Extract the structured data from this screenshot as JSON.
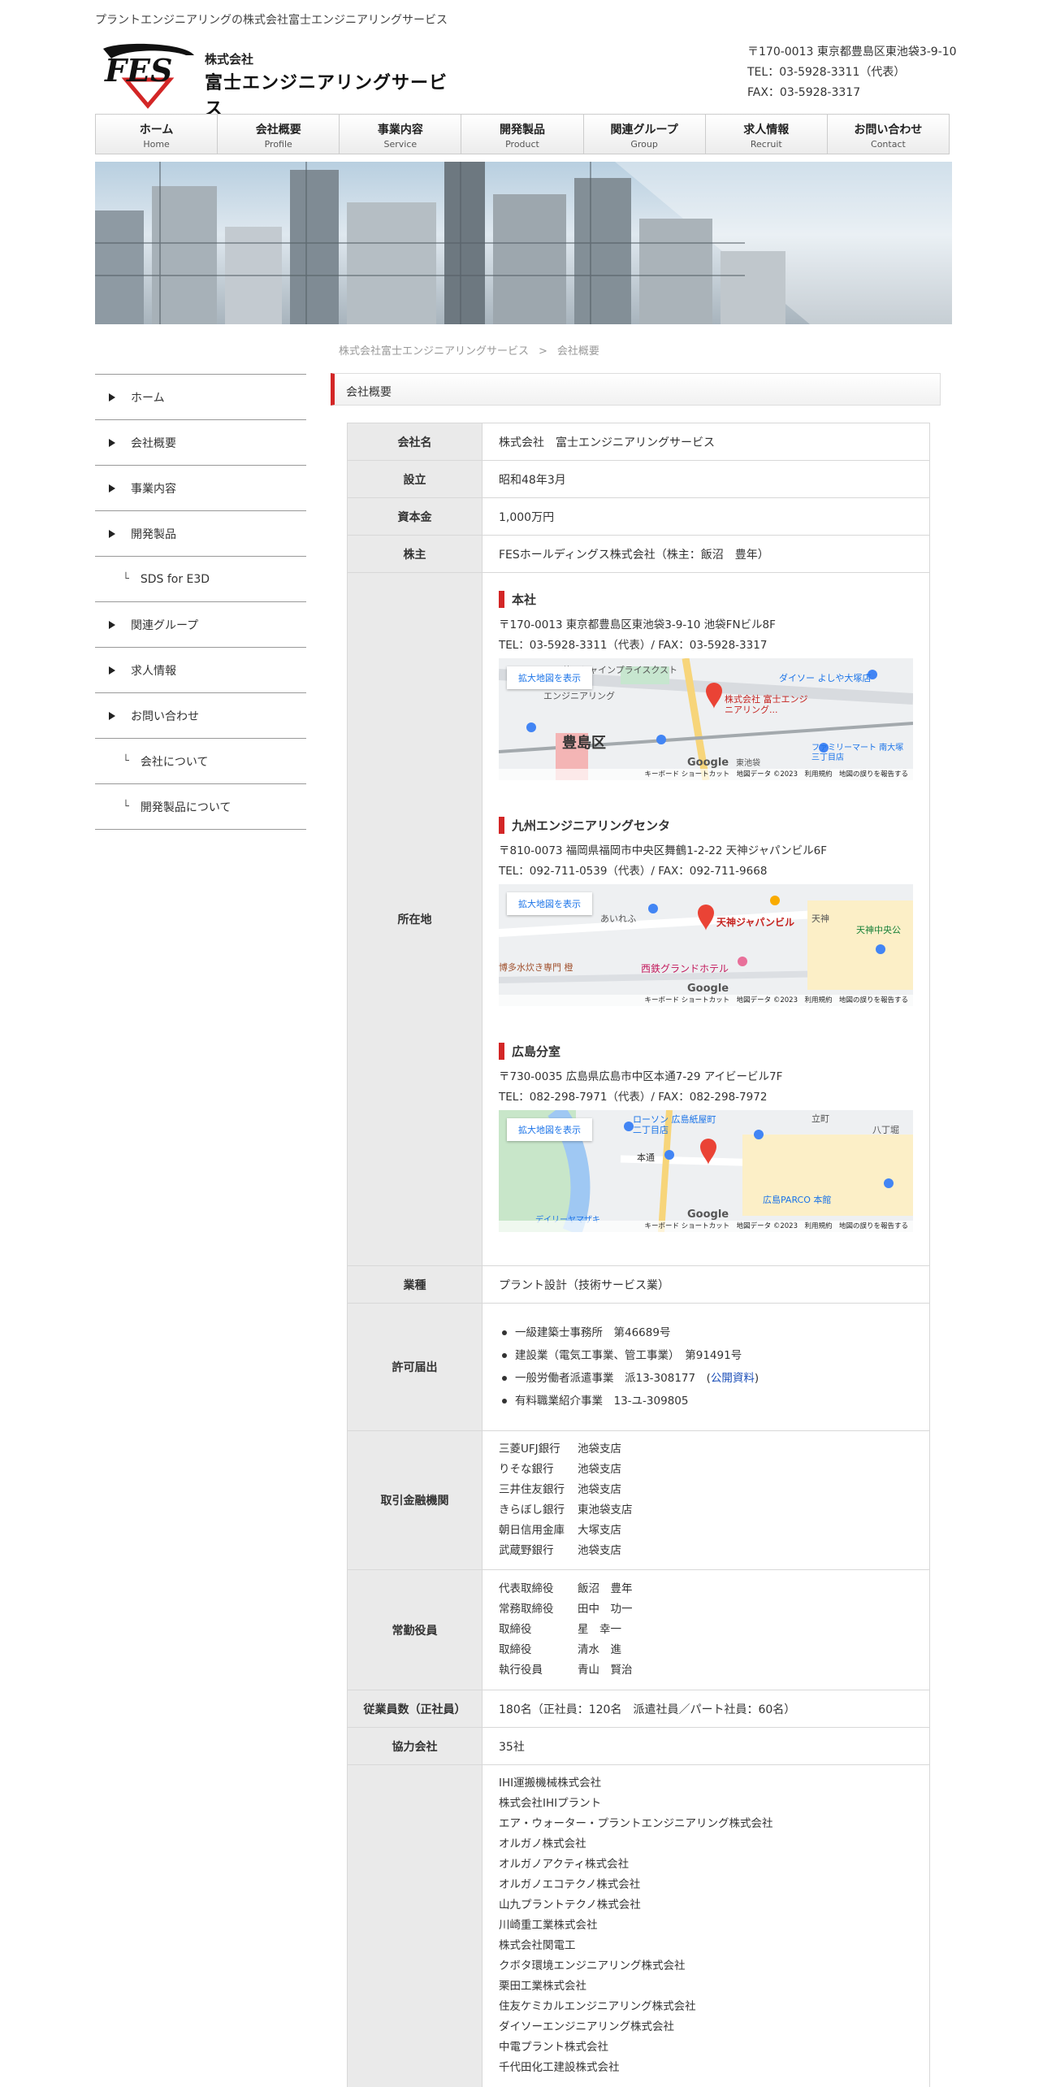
{
  "header": {
    "tagline": "プラントエンジニアリングの株式会社富士エンジニアリングサービス",
    "logo_mark": "FES",
    "company_type": "株式会社",
    "company_name": "富士エンジニアリングサービス",
    "address": "〒170-0013 東京都豊島区東池袋3-9-10",
    "tel": "TEL：03-5928-3311（代表）",
    "fax": "FAX：03-5928-3317"
  },
  "nav": [
    {
      "ja": "ホーム",
      "en": "Home"
    },
    {
      "ja": "会社概要",
      "en": "Profile"
    },
    {
      "ja": "事業内容",
      "en": "Service"
    },
    {
      "ja": "開発製品",
      "en": "Product"
    },
    {
      "ja": "関連グループ",
      "en": "Group"
    },
    {
      "ja": "求人情報",
      "en": "Recruit"
    },
    {
      "ja": "お問い合わせ",
      "en": "Contact"
    }
  ],
  "breadcrumb": {
    "home": "株式会社富士エンジニアリングサービス",
    "sep": ">",
    "current": "会社概要"
  },
  "sidebar": [
    {
      "label": "ホーム",
      "sub": false
    },
    {
      "label": "会社概要",
      "sub": false
    },
    {
      "label": "事業内容",
      "sub": false
    },
    {
      "label": "開発製品",
      "sub": false
    },
    {
      "label": "SDS for E3D",
      "sub": true
    },
    {
      "label": "関連グループ",
      "sub": false
    },
    {
      "label": "求人情報",
      "sub": false
    },
    {
      "label": "お問い合わせ",
      "sub": false
    },
    {
      "label": "会社について",
      "sub": true
    },
    {
      "label": "開発製品について",
      "sub": true
    }
  ],
  "sub_mark": "└",
  "page_title": "会社概要",
  "table": {
    "company_name_label": "会社名",
    "company_name_value": "株式会社　富士エンジニアリングサービス",
    "founded_label": "設立",
    "founded_value": "昭和48年3月",
    "capital_label": "資本金",
    "capital_value": "1,000万円",
    "shareholder_label": "株主",
    "shareholder_value": "FESホールディングス株式会社（株主：飯沼　豊年）",
    "location_label": "所在地",
    "offices": [
      {
        "name": "本社",
        "address": "〒170-0013 東京都豊島区東池袋3-9-10 池袋FNビル8F",
        "phone": "TEL：03-5928-3311（代表）/ FAX：03-5928-3317",
        "map_labels": [
          "サンシャインプライスクスト",
          "エンジニアリング",
          "株式会社 富士エンジニアリング...",
          "豊島区",
          "ダイソー よしや大塚店",
          "ファミリーマート 南大塚三丁目店",
          "東池袋"
        ]
      },
      {
        "name": "九州エンジニアリングセンタ",
        "address": "〒810-0073 福岡県福岡市中央区舞鶴1-2-22 天神ジャパンビル6F",
        "phone": "TEL：092-711-0539（代表）/ FAX：092-711-9668",
        "map_labels": [
          "天神ジャパンビル",
          "西鉄グランドホテル",
          "博多水炊き専門 橙",
          "天神中央公",
          "あいれふ",
          "天神"
        ]
      },
      {
        "name": "広島分室",
        "address": "〒730-0035 広島県広島市中区本通7-29 アイビービル7F",
        "phone": "TEL：082-298-7971（代表）/ FAX：082-298-7972",
        "map_labels": [
          "ローソン 広島紙屋町二丁目店",
          "本通",
          "広島PARCO 本館",
          "八丁堀",
          "立町",
          "デイリーヤマザキ"
        ]
      }
    ],
    "map_button": "拡大地図を表示",
    "map_footer": "キーボード ショートカット　地図データ ©2023　利用規約　地図の誤りを報告する",
    "map_google": "Google",
    "industry_label": "業種",
    "industry_value": "プラント設計（技術サービス業）",
    "license_label": "許可届出",
    "licenses": [
      {
        "text": "一級建築士事務所　第46689号",
        "link": ""
      },
      {
        "text": "建設業（電気工事業、管工事業）　第91491号",
        "link": ""
      },
      {
        "text": "一般労働者派遣事業　派13-308177　(",
        "link": "公開資料",
        "after": ")"
      },
      {
        "text": "有料職業紹介事業　13-ユ-309805",
        "link": ""
      }
    ],
    "banks_label": "取引金融機関",
    "banks": [
      [
        "三菱UFJ銀行",
        "池袋支店"
      ],
      [
        "りそな銀行",
        "池袋支店"
      ],
      [
        "三井住友銀行",
        "池袋支店"
      ],
      [
        "きらぼし銀行",
        "東池袋支店"
      ],
      [
        "朝日信用金庫",
        "大塚支店"
      ],
      [
        "武蔵野銀行",
        "池袋支店"
      ]
    ],
    "officers_label": "常勤役員",
    "officers": [
      [
        "代表取締役",
        "飯沼　豊年"
      ],
      [
        "常務取締役",
        "田中　功一"
      ],
      [
        "取締役",
        "星　幸一"
      ],
      [
        "取締役",
        "清水　進"
      ],
      [
        "執行役員",
        "青山　賢治"
      ]
    ],
    "employees_label": "従業員数（正社員）",
    "employees_value": "180名（正社員：120名　派遣社員／パート社員：60名）",
    "partners_label": "協力会社",
    "partners_value": "35社",
    "clients": [
      "IHI運搬機械株式会社",
      "株式会社IHIプラント",
      "エア・ウォーター・プラントエンジニアリング株式会社",
      "オルガノ株式会社",
      "オルガノアクティ株式会社",
      "オルガノエコテクノ株式会社",
      "山九プラントテクノ株式会社",
      "川崎重工業株式会社",
      "株式会社関電工",
      "クボタ環境エンジニアリング株式会社",
      "栗田工業株式会社",
      "住友ケミカルエンジニアリング株式会社",
      "ダイソーエンジニアリング株式会社",
      "中電プラント株式会社",
      "千代田化工建設株式会社"
    ]
  },
  "colors": {
    "accent": "#d32626",
    "link": "#1c4fb8",
    "key_cell": "#eaeaea"
  }
}
